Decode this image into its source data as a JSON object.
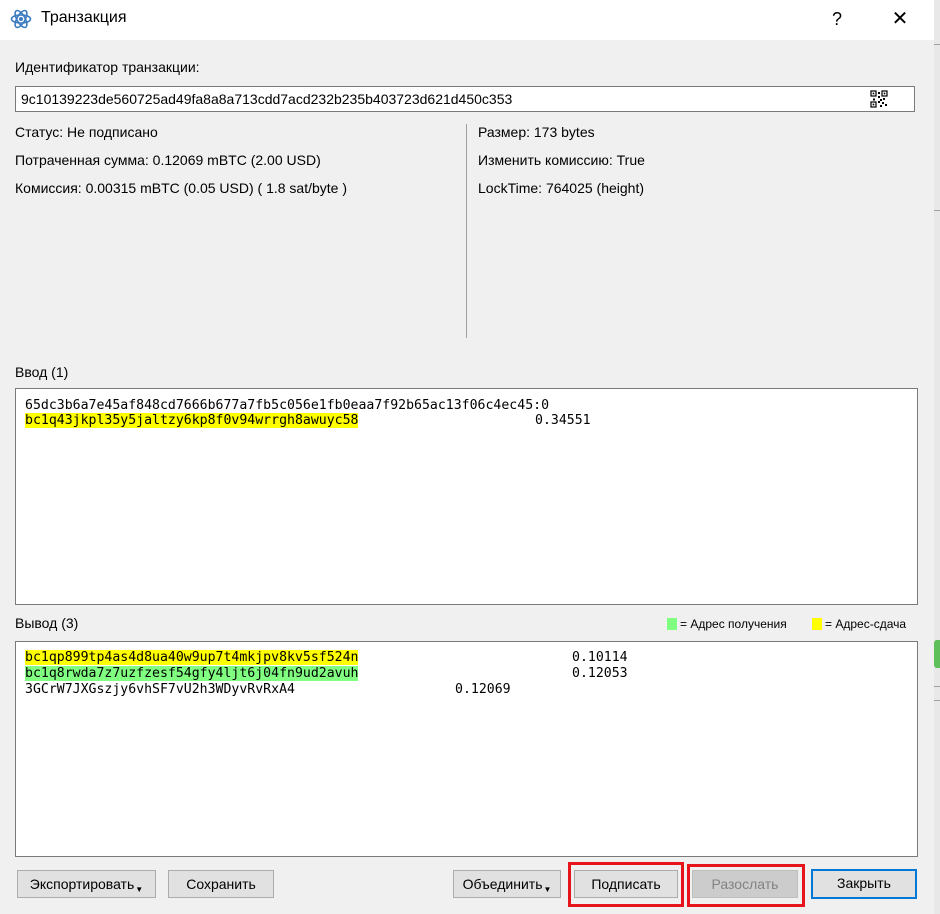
{
  "window": {
    "title": "Транзакция",
    "help_label": "?",
    "close_label": "✕"
  },
  "txid": {
    "label": "Идентификатор транзакции:",
    "value": "9c10139223de560725ad49fa8a8a713cdd7acd232b235b403723d621d450c353"
  },
  "details_left": {
    "status": "Статус: Не подписано",
    "amount": "Потраченная сумма: 0.12069 mBTC (2.00 USD)",
    "fee": "Комиссия: 0.00315 mBTC (0.05 USD)  ( 1.8 sat/byte )"
  },
  "details_right": {
    "size": "Размер: 173 bytes",
    "rbf": "Изменить комиссию: True",
    "locktime": "LockTime: 764025 (height)"
  },
  "inputs": {
    "label": "Ввод (1)",
    "items": [
      {
        "prevout": "65dc3b6a7e45af848cd7666b677a7fb5c056e1fb0eaa7f92b65ac13f06c4ec45:0",
        "address": "bc1q43jkpl35y5jaltzy6kp8f0v94wrrgh8awuyc58",
        "amount": "0.34551",
        "highlight": "yellow"
      }
    ]
  },
  "outputs": {
    "label": "Вывод (3)",
    "legend_receive": "= Адрес получения",
    "legend_change": "= Адрес-сдача",
    "items": [
      {
        "address": "bc1qp899tp4as4d8ua40w9up7t4mkjpv8kv5sf524n",
        "amount": "0.10114",
        "highlight": "yellow"
      },
      {
        "address": "bc1q8rwda7z7uzfzesf54gfy4ljt6j04fn9ud2avuh",
        "amount": "0.12053",
        "highlight": "green"
      },
      {
        "address": "3GCrW7JXGszjy6vhSF7vU2h3WDyvRvRxA4",
        "amount": "0.12069",
        "highlight": "none"
      }
    ]
  },
  "buttons": {
    "export": "Экспортировать",
    "save": "Сохранить",
    "combine": "Объединить",
    "sign": "Подписать",
    "broadcast": "Разослать",
    "close": "Закрыть"
  },
  "colors": {
    "receive": "#80ff80",
    "change": "#ffff00",
    "annotation": "#e8141c",
    "default_button": "#0078d7"
  }
}
